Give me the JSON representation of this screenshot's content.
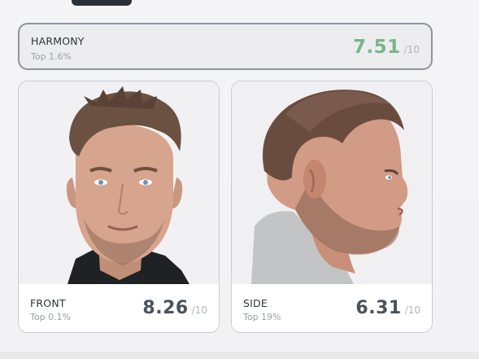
{
  "harmony": {
    "label": "HARMONY",
    "rank": "Top 1.6%",
    "score": "7.51",
    "out_of": "/10",
    "score_color": "#79b58a"
  },
  "front": {
    "label": "FRONT",
    "rank": "Top 0.1%",
    "score": "8.26",
    "out_of": "/10",
    "score_color": "#4b5259"
  },
  "side": {
    "label": "SIDE",
    "rank": "Top 19%",
    "score": "6.31",
    "out_of": "/10",
    "score_color": "#4b5259"
  }
}
